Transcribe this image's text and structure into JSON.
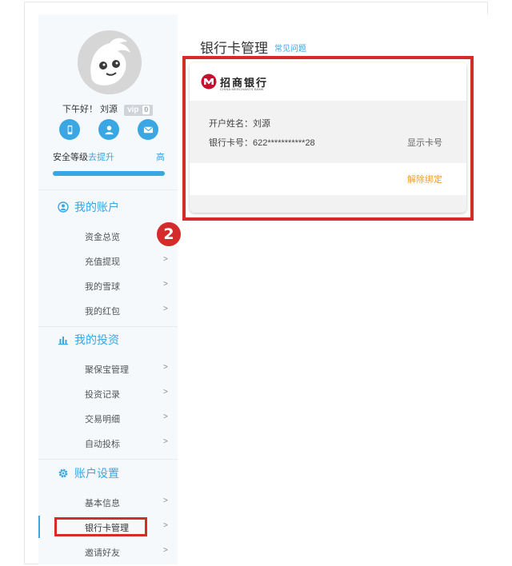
{
  "profile": {
    "greeting": "下午好！ 刘源",
    "vip_label": "vip",
    "vip_level": "0",
    "security_label": "安全等级",
    "security_upgrade": "去提升",
    "security_level": "高",
    "security_progress": 1.0,
    "icons": [
      "phone-icon",
      "user-icon",
      "mail-icon"
    ]
  },
  "sidebar": {
    "groups": [
      {
        "title": "我的账户",
        "icon": "account-icon",
        "items": [
          {
            "label": "资金总览",
            "arrow": ""
          },
          {
            "label": "充值提现",
            "arrow": ">"
          },
          {
            "label": "我的雪球",
            "arrow": ">"
          },
          {
            "label": "我的红包",
            "arrow": ">"
          }
        ]
      },
      {
        "title": "我的投资",
        "icon": "bar-chart-icon",
        "items": [
          {
            "label": "聚保宝管理",
            "arrow": ">"
          },
          {
            "label": "投资记录",
            "arrow": ">"
          },
          {
            "label": "交易明细",
            "arrow": ">"
          },
          {
            "label": "自动投标",
            "arrow": ">"
          }
        ]
      },
      {
        "title": "账户设置",
        "icon": "gear-icon",
        "items": [
          {
            "label": "基本信息",
            "arrow": ">"
          },
          {
            "label": "银行卡管理",
            "arrow": ">"
          },
          {
            "label": "邀请好友",
            "arrow": ">"
          }
        ]
      }
    ]
  },
  "step_badge": "2",
  "main": {
    "title": "银行卡管理",
    "faq_link": "常见问题",
    "card": {
      "bank_name": "招商银行",
      "bank_name_en": "CHINA MERCHANTS BANK",
      "holder": "开户姓名：刘源",
      "card_number": "银行卡号：622***********28",
      "show_number": "显示卡号",
      "unbind": "解除绑定"
    }
  },
  "colors": {
    "accent": "#3aa6e3",
    "highlight": "#d42b2b",
    "orange_link": "#f39c2b",
    "bank_red": "#c8102e"
  }
}
